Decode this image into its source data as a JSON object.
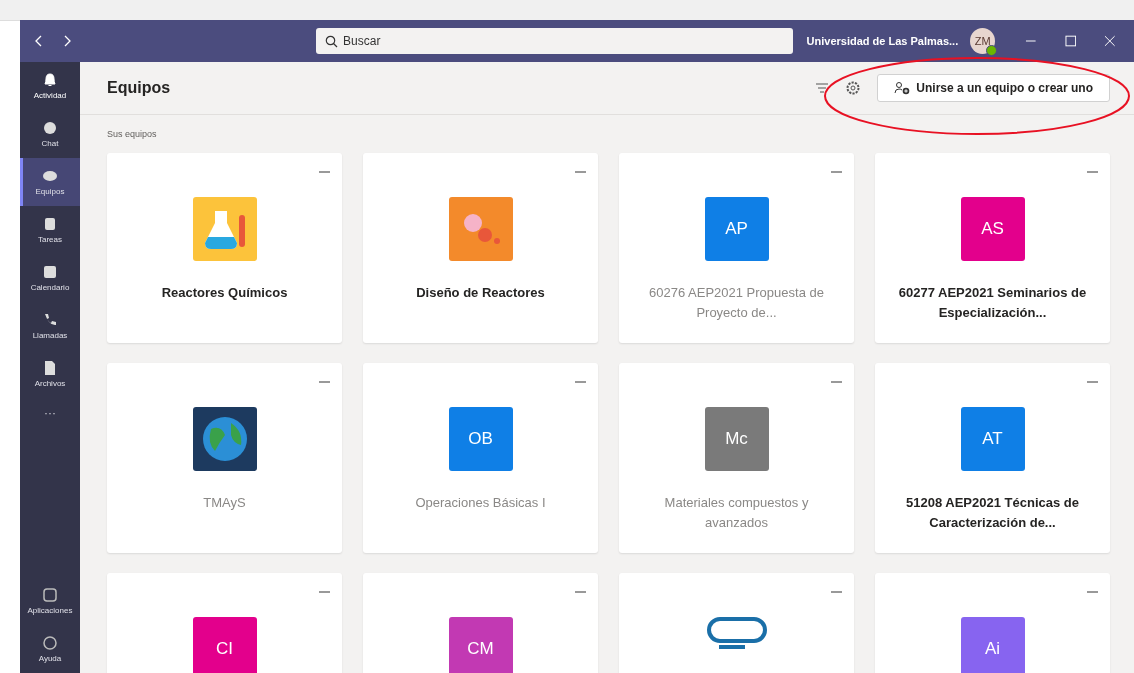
{
  "titlebar": {
    "search": {
      "placeholder": "Buscar"
    },
    "organization": "Universidad de Las Palmas...",
    "avatar": {
      "initials": "ZM",
      "online": true
    }
  },
  "sidebar": {
    "items": [
      {
        "label": "Actividad",
        "selected": false
      },
      {
        "label": "Chat",
        "selected": false
      },
      {
        "label": "Equipos",
        "selected": true
      },
      {
        "label": "Tareas",
        "selected": false
      },
      {
        "label": "Calendario",
        "selected": false
      },
      {
        "label": "Llamadas",
        "selected": false
      },
      {
        "label": "Archivos",
        "selected": false
      }
    ],
    "more": "···",
    "bottom_items": [
      {
        "label": "Aplicaciones",
        "selected": false
      },
      {
        "label": "Ayuda",
        "selected": false
      }
    ]
  },
  "header": {
    "title": "Equipos",
    "join_button": "Unirse a un equipo o crear uno",
    "annotation": {
      "kind": "ellipse",
      "color": "#e81123"
    }
  },
  "section_label": "Sus equipos",
  "teams": [
    {
      "name": "Reactores Químicos",
      "unread": true,
      "kind": "flask"
    },
    {
      "name": "Diseño de Reactores",
      "unread": true,
      "kind": "gears"
    },
    {
      "name": "60276 AEP2021 Propuesta de Proyecto de...",
      "unread": false,
      "kind": "initials",
      "initials": "AP",
      "color": "#0f7fe6"
    },
    {
      "name": "60277 AEP2021 Seminarios de Especialización...",
      "unread": true,
      "kind": "initials",
      "initials": "AS",
      "color": "#e3008c"
    },
    {
      "name": "TMAyS",
      "unread": false,
      "kind": "globe"
    },
    {
      "name": "Operaciones Básicas I",
      "unread": false,
      "kind": "initials",
      "initials": "OB",
      "color": "#0f7fe6"
    },
    {
      "name": "Materiales compuestos y avanzados",
      "unread": false,
      "kind": "initials",
      "initials": "Mc",
      "color": "#7a7a7a"
    },
    {
      "name": "51208 AEP2021 Técnicas de Caracterización de...",
      "unread": true,
      "kind": "initials",
      "initials": "AT",
      "color": "#0f7fe6"
    },
    {
      "kind": "initials",
      "initials": "CI",
      "color": "#e3008c"
    },
    {
      "kind": "initials",
      "initials": "CM",
      "color": "#c239b3"
    },
    {
      "kind": "chain"
    },
    {
      "kind": "initials",
      "initials": "Ai",
      "color": "#8764f0"
    }
  ]
}
